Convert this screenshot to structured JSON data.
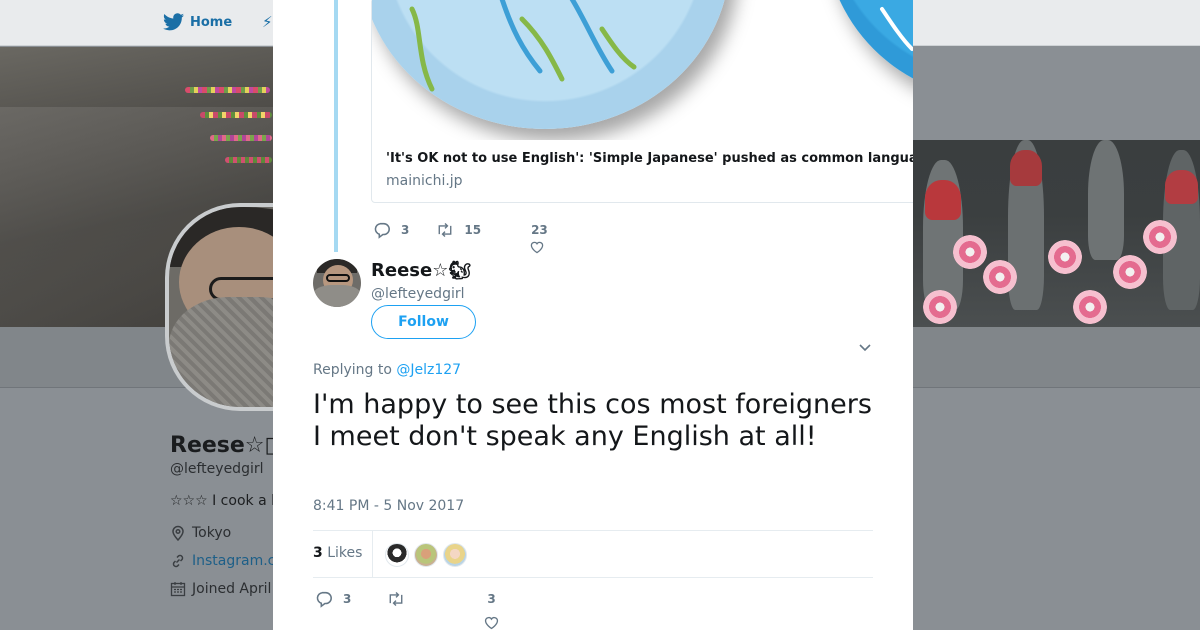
{
  "nav": {
    "home_label": "Home"
  },
  "profile": {
    "name": "Reese☆",
    "name_glyph": "▯",
    "handle": "@lefteyedgirl",
    "bio": "☆☆☆ I cook a l",
    "location": "Tokyo",
    "link": "Instagram.c",
    "joined": "Joined April"
  },
  "modal": {
    "quoted_card": {
      "title": "'It's OK not to use English': 'Simple Japanese' pushed as common language with foreigners - The Mainichi",
      "domain": "mainichi.jp"
    },
    "parent_actions": {
      "replies": "3",
      "retweets": "15",
      "likes": "23"
    },
    "tweet": {
      "author_name": "Reese☆🐿",
      "author_handle": "@lefteyedgirl",
      "follow_label": "Follow",
      "replying_prefix": "Replying to",
      "replying_to": "@Jelz127",
      "text": "I'm happy to see this cos most foreigners I meet don't speak any English at all!",
      "timestamp": "8:41 PM - 5 Nov 2017",
      "likes_count": "3",
      "likes_label": "Likes"
    },
    "tweet_actions": {
      "replies": "3",
      "likes": "3"
    }
  },
  "icons": {
    "home": "twitter-bird-icon",
    "reply": "reply-icon",
    "retweet": "retweet-icon",
    "like": "heart-icon",
    "location": "location-pin-icon",
    "link": "link-icon",
    "calendar": "calendar-icon",
    "caret": "chevron-down-icon"
  },
  "colors": {
    "accent": "#1da1f2",
    "thread_line": "#a5d9f2",
    "overlay": "#8a8f94",
    "text": "#14171a",
    "muted": "#657786"
  }
}
